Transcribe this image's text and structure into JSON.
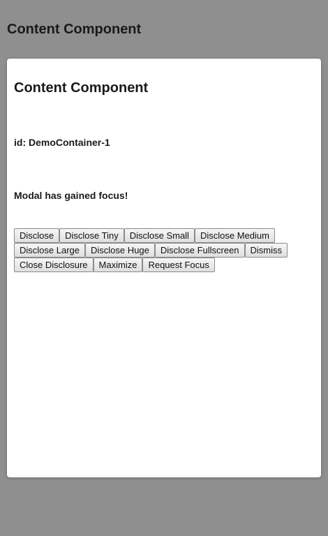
{
  "page": {
    "title": "Content Component"
  },
  "modal": {
    "title": "Content Component",
    "id_text": "id: DemoContainer-1",
    "status_text": "Modal has gained focus!",
    "buttons": {
      "disclose": "Disclose",
      "disclose_tiny": "Disclose Tiny",
      "disclose_small": "Disclose Small",
      "disclose_medium": "Disclose Medium",
      "disclose_large": "Disclose Large",
      "disclose_huge": "Disclose Huge",
      "disclose_fullscreen": "Disclose Fullscreen",
      "dismiss": "Dismiss",
      "close_disclosure": "Close Disclosure",
      "maximize": "Maximize",
      "request_focus": "Request Focus"
    }
  },
  "colors": {
    "backdrop": "#8f8f8f",
    "panel": "#ffffff",
    "text": "#1a1a1a"
  }
}
